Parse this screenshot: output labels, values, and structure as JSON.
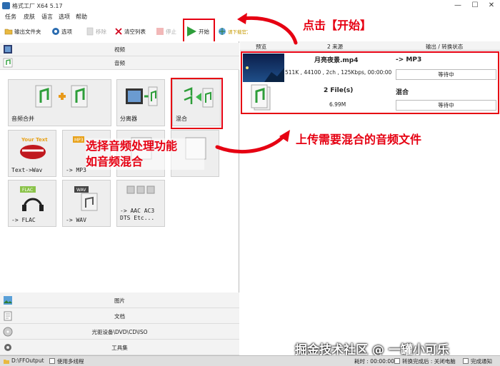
{
  "window": {
    "title": "格式工厂 X64 5.17",
    "minimize": "—",
    "maximize": "☐",
    "close": "✕"
  },
  "menu": [
    "任务",
    "皮肤",
    "语言",
    "选项",
    "帮助"
  ],
  "toolbar": {
    "output_folder": "输出文件夹",
    "options": "选项",
    "remove": "移除",
    "clear_list": "清空列表",
    "stop": "停止",
    "start": "开始",
    "download_video": "请下载官方正式版"
  },
  "categories": {
    "video": "视频",
    "audio": "音频",
    "picture": "图片",
    "document": "文档",
    "disc": "光驱设备\\DVD\\CD\\ISO",
    "tools": "工具集"
  },
  "audio_tiles": [
    {
      "label": "音频合并",
      "icon": "audio-join-icon"
    },
    {
      "label": "分离器",
      "icon": "splitter-icon"
    },
    {
      "label": "混合",
      "icon": "mix-icon"
    },
    {
      "label": "Text->Wav",
      "icon": "your-text-icon"
    },
    {
      "label": "-> MP3",
      "icon": "mp3-icon"
    },
    {
      "label": "",
      "icon": "wma-icon"
    },
    {
      "label": "",
      "icon": "audio-icon"
    },
    {
      "label": "-> FLAC",
      "icon": "flac-icon"
    },
    {
      "label": "-> WAV",
      "icon": "wav-icon"
    },
    {
      "label": "-> AAC AC3 DTS Etc...",
      "icon": "other-formats-icon"
    }
  ],
  "list": {
    "headers": {
      "preview": "预览",
      "source": "2 来源",
      "output": "输出 / 转换状态"
    },
    "rows": [
      {
        "name": "月亮夜景.mp4",
        "info": "511K , 44100 , 2ch , 125Kbps, 00:00:00",
        "target": "-> MP3",
        "status": "等待中"
      },
      {
        "name": "2 File(s)",
        "info": "6.99M",
        "target": "混合",
        "status": "等待中"
      }
    ]
  },
  "annotations": {
    "click_start": "点击【开始】",
    "choose_mix": "选择音频处理功能\n如音频混合",
    "upload_files": "上传需要混合的音频文件"
  },
  "watermark": "掘金技术社区 @ 一罐小可乐",
  "statusbar": {
    "output_path": "D:\\FFOutput",
    "multithread": "使用多线程",
    "elapsed": "耗时 : 00:00:00",
    "after_convert": "转换完成后 : 关闭电脑",
    "notify": "完成通知"
  },
  "colors": {
    "accent": "#e60012",
    "start_green": "#2e9e3a"
  }
}
